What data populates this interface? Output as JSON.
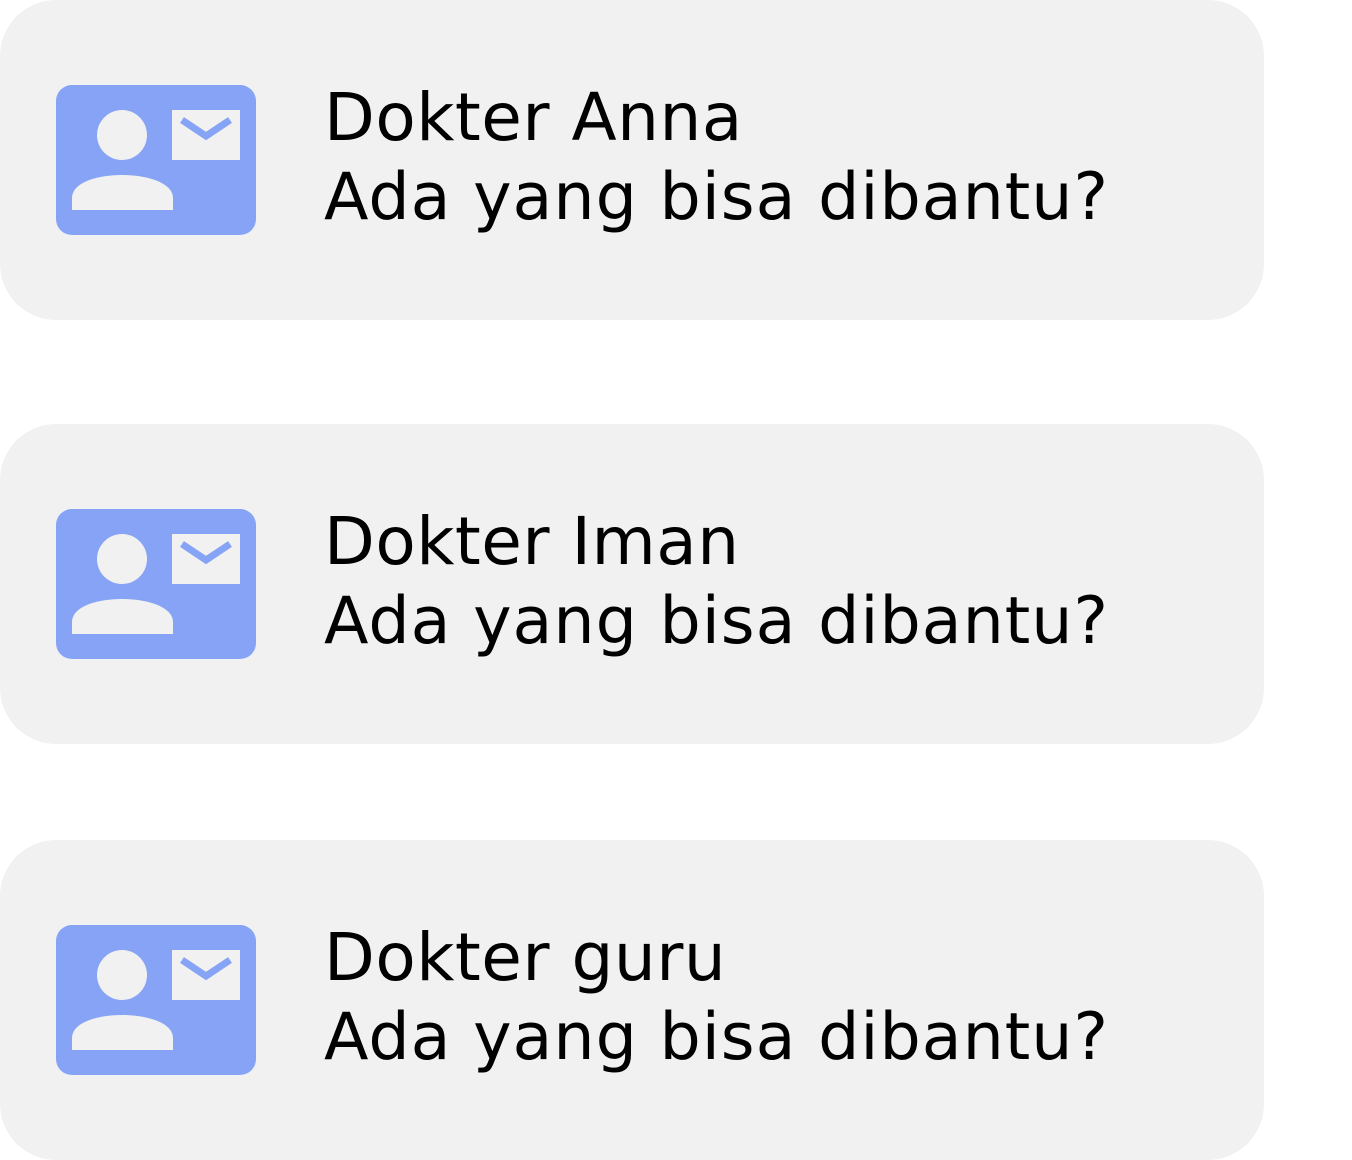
{
  "theme": {
    "card_background": "#f1f1f1",
    "icon_background": "#87a3f5",
    "icon_foreground": "#f1f1f1",
    "text_color": "#000000"
  },
  "chat_list": [
    {
      "icon": "contact-mail-icon",
      "name": "Dokter Anna",
      "message": "Ada yang bisa dibantu?"
    },
    {
      "icon": "contact-mail-icon",
      "name": "Dokter Iman",
      "message": "Ada yang bisa dibantu?"
    },
    {
      "icon": "contact-mail-icon",
      "name": "Dokter guru",
      "message": "Ada yang bisa dibantu?"
    }
  ]
}
